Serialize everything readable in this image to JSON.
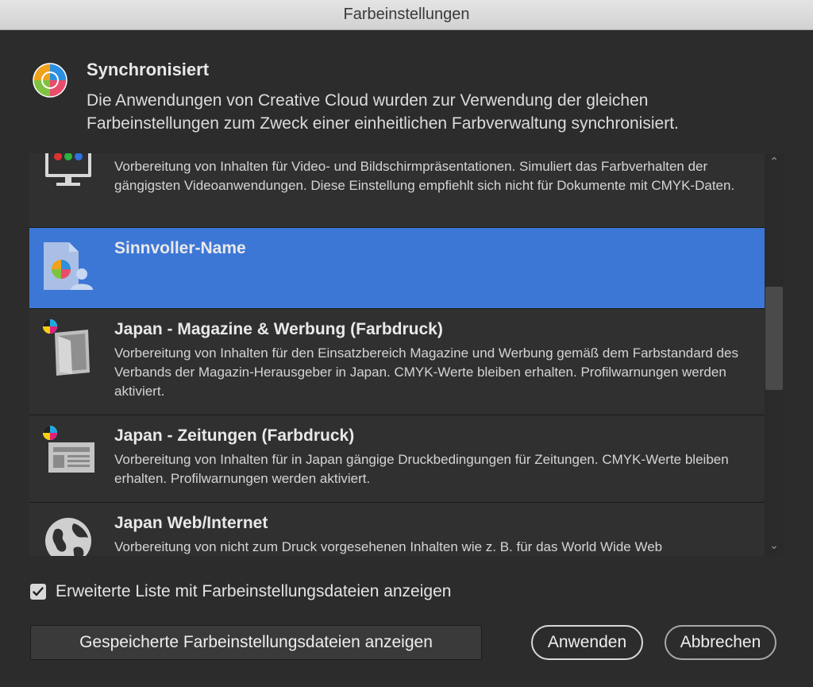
{
  "window": {
    "title": "Farbeinstellungen"
  },
  "sync": {
    "title": "Synchronisiert",
    "description": "Die Anwendungen von Creative Cloud wurden zur Verwendung der gleichen Farbeinstellungen zum Zweck einer einheitlichen Farbverwaltung synchronisiert.",
    "icon": "color-wheel-icon"
  },
  "list": {
    "items": [
      {
        "title": "",
        "description": "Vorbereitung von Inhalten für Video- und Bildschirmpräsentationen. Simuliert das Farbverhalten der gängigsten Videoanwendungen. Diese Einstellung empfiehlt sich nicht für Dokumente mit CMYK-Daten.",
        "icon": "monitor-icon",
        "selected": false
      },
      {
        "title": "Sinnvoller-Name",
        "description": "",
        "icon": "custom-document-icon",
        "selected": true
      },
      {
        "title": "Japan - Magazine & Werbung (Farbdruck)",
        "description": "Vorbereitung von Inhalten für den Einsatzbereich Magazine und Werbung gemäß dem Farbstandard des Verbands der Magazin-Herausgeber in Japan. CMYK-Werte bleiben erhalten. Profilwarnungen werden aktiviert.",
        "icon": "magazine-icon",
        "selected": false
      },
      {
        "title": "Japan - Zeitungen (Farbdruck)",
        "description": "Vorbereitung von Inhalten für in Japan gängige Druckbedingungen für Zeitungen. CMYK-Werte bleiben erhalten. Profilwarnungen werden aktiviert.",
        "icon": "newspaper-icon",
        "selected": false
      },
      {
        "title": "Japan Web/Internet",
        "description": "Vorbereitung von nicht zum Druck vorgesehenen Inhalten wie z. B. für das World Wide Web",
        "icon": "globe-icon",
        "selected": false
      }
    ]
  },
  "options": {
    "show_extended_list_label": "Erweiterte Liste mit Farbeinstellungsdateien anzeigen",
    "show_extended_list_checked": true
  },
  "buttons": {
    "show_saved": "Gespeicherte Farbeinstellungsdateien anzeigen",
    "apply": "Anwenden",
    "cancel": "Abbrechen"
  },
  "colors": {
    "selection": "#3d77d6",
    "background": "#2c2c2c"
  }
}
